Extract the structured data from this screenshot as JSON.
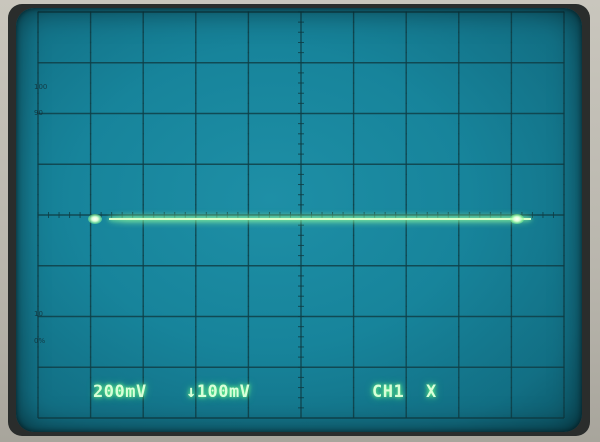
{
  "screen": {
    "phosphor_color": "#d8ffd8",
    "background_color": "#1a88a0",
    "graticule_color": "#0f3f48",
    "divisions": {
      "horizontal": 10,
      "vertical": 8
    },
    "trace": {
      "type": "flat-line",
      "level_div": 0
    }
  },
  "scale_marks": {
    "top_upper": "100",
    "top_lower": "90",
    "bottom_upper": "10",
    "bottom_lower": "0%"
  },
  "readout": {
    "volts_div": "200mV",
    "offset": "↓100mV",
    "channel": "CH1",
    "mode": "X"
  }
}
